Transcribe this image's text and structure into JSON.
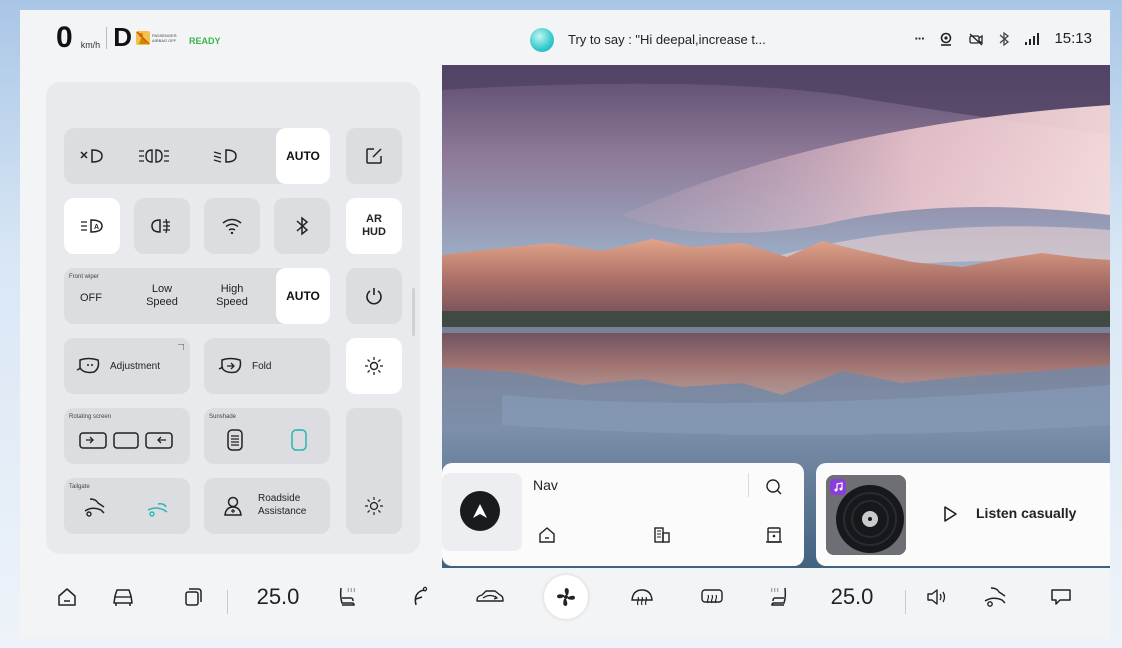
{
  "status": {
    "speed": "0",
    "speed_unit": "km/h",
    "gear": "D",
    "airbag_label": "PASSENGER AIRBAG OFF",
    "ready": "READY",
    "voice_hint": "Try to say : \"Hi deepal,increase t...",
    "time": "15:13",
    "more": "···"
  },
  "controls": {
    "lights_auto": "AUTO",
    "ar_hud": [
      "AR",
      "HUD"
    ],
    "wiper_title": "Front wiper",
    "wiper_off": "OFF",
    "wiper_low": [
      "Low",
      "Speed"
    ],
    "wiper_high": [
      "High",
      "Speed"
    ],
    "wiper_auto": "AUTO",
    "adjustment": "Adjustment",
    "fold": "Fold",
    "rotating_screen": "Rotating screen",
    "sunshade": "Sunshade",
    "tailgate": "Tailgate",
    "roadside": [
      "Roadside",
      "Assistance"
    ]
  },
  "nav_card": {
    "title": "Nav"
  },
  "music_card": {
    "listen": "Listen casually"
  },
  "dock": {
    "temp_left": "25.0",
    "temp_right": "25.0"
  },
  "icons": {
    "voice": "voice-assistant-orb",
    "status": [
      "more-dots-icon",
      "face-id-icon",
      "camera-off-icon",
      "bluetooth-icon",
      "signal-icon"
    ]
  }
}
